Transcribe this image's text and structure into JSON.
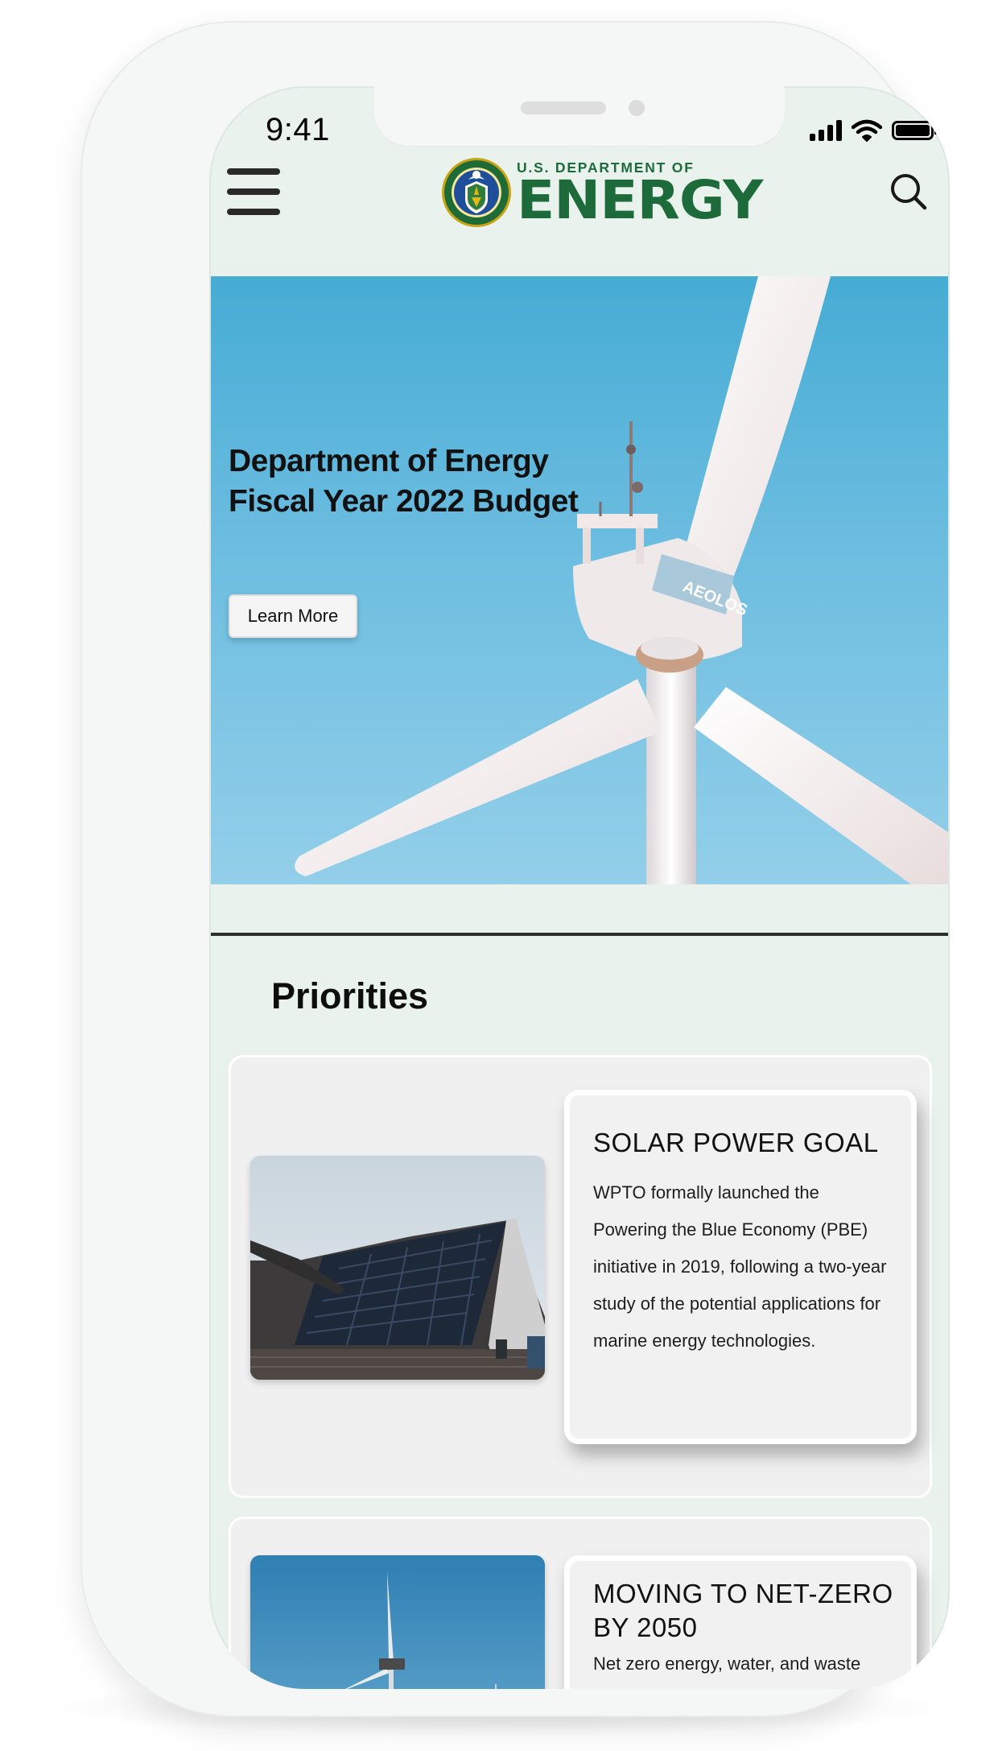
{
  "status_bar": {
    "time": "9:41"
  },
  "header": {
    "logo_small": "U.S. DEPARTMENT OF",
    "logo_big": "ENERGY"
  },
  "hero": {
    "title": "Department of Energy Fiscal Year 2022 Budget",
    "button_label": "Learn More",
    "turbine_text": "AEOLOS"
  },
  "priorities": {
    "title": "Priorities",
    "cards": [
      {
        "title": "SOLAR POWER GOAL",
        "body": "WPTO formally launched the Powering the Blue Economy (PBE) initiative in 2019, following a two-year study of the potential applications for marine energy technologies."
      },
      {
        "title": "MOVING TO NET-ZERO BY 2050",
        "body": "Net zero energy, water, and waste"
      }
    ]
  },
  "colors": {
    "brand_green": "#1d6b3a",
    "screen_bg": "#eaf2ee",
    "sky_blue": "#46acd4"
  }
}
